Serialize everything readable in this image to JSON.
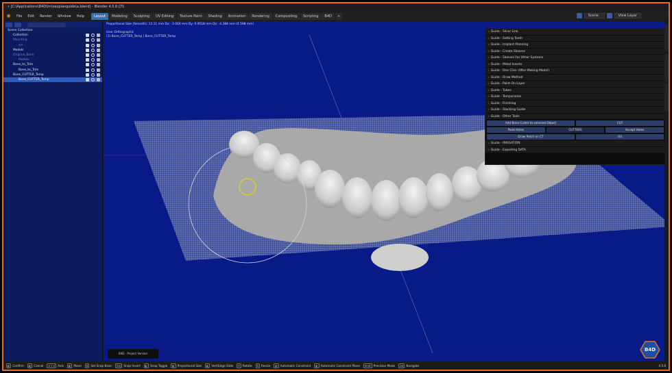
{
  "window": {
    "title": "• [C:\\Applications\\B4D\\lm\\seoplanguide\\a.blend] - Blender 4.5.8 LTS"
  },
  "menubar": {
    "menus": [
      "File",
      "Edit",
      "Render",
      "Window",
      "Help"
    ],
    "workspaces": [
      "Layout",
      "Modeling",
      "Sculpting",
      "UV Editing",
      "Texture Paint",
      "Shading",
      "Animation",
      "Rendering",
      "Compositing",
      "Scripting",
      "B4D"
    ],
    "active_workspace": "Layout",
    "plus": "+",
    "scene_label": "Scene",
    "view_layer_label": "View Layer"
  },
  "outliner": {
    "rows": [
      {
        "label": "Scene Collection",
        "indent": 0,
        "state": "normal",
        "icons": false
      },
      {
        "label": "Collection",
        "indent": 1,
        "state": "normal",
        "icons": true
      },
      {
        "label": "Mounting",
        "indent": 1,
        "state": "dim",
        "icons": true
      },
      {
        "label": "sm",
        "indent": 2,
        "state": "dim",
        "icons": true
      },
      {
        "label": "Models",
        "indent": 1,
        "state": "normal",
        "icons": true
      },
      {
        "label": "Original_Bone",
        "indent": 1,
        "state": "dim",
        "icons": true
      },
      {
        "label": "Models",
        "indent": 2,
        "state": "dim",
        "icons": true
      },
      {
        "label": "Bone_to_Trim",
        "indent": 1,
        "state": "normal",
        "icons": true
      },
      {
        "label": "Bone_to_Trim",
        "indent": 2,
        "state": "normal",
        "icons": true
      },
      {
        "label": "Bone_CUTTER_Temp",
        "indent": 1,
        "state": "normal",
        "icons": true
      },
      {
        "label": "Bone_CUTTER_Temp",
        "indent": 2,
        "state": "selected",
        "icons": true
      }
    ]
  },
  "viewport": {
    "view_name": "User Orthographic",
    "object_info": "(1) Bone_CUTTER_Temp | Bone_CUTTER_Temp",
    "header_info": "Proportional Size (Smooth): 13.11 mm   Dx: -1.004 mm   Dy: 0.9518 mm   Dz: -4.384 mm (4.598 mm)",
    "timeline_button": "B4D - Project Version Timeline"
  },
  "b4d_panel": {
    "guides_top": [
      "Guide - Slicer Link",
      "Guide - Setting Teeth",
      "Guide - Implant Planning",
      "Guide - Create Sleeves",
      "Guide - Sleeves For Other Systems",
      "Guide - Metal Inserts",
      "Guide - One Click  (After Making Model)",
      "Guide - Draw Method",
      "Guide - Paint-On-Layer",
      "Guide - Tubes",
      "Guide - Temporaries",
      "Guide - Finishing",
      "Guide - Stacking Guide",
      "Guide - Other Tools"
    ],
    "tool_buttons": {
      "add_bone_cutter": "Add Bone Cutter to selected Object",
      "cut": "CUT",
      "paint_holes": "Paint Holes",
      "cutters": "CUTTERS",
      "accept_holes": "Accept Holes",
      "draw_patch": "Draw Patch on CT",
      "fill": "Fill"
    },
    "guides_bottom": [
      "Guide - IRRIGATION",
      "Guide - Exporting DATA"
    ]
  },
  "statusbar": {
    "items": [
      {
        "key": "",
        "label": "Confirm"
      },
      {
        "key": "",
        "label": "Cancel"
      },
      {
        "key": "X Y Z",
        "label": "Axis"
      },
      {
        "key": "",
        "label": "Plane"
      },
      {
        "key": "B",
        "label": "Set Snap Base"
      },
      {
        "key": "Ctrl",
        "label": "Snap Invert"
      },
      {
        "key": "",
        "label": "Snap Toggle"
      },
      {
        "key": "",
        "label": "Proportional Size"
      },
      {
        "key": "",
        "label": "Vert/Edge Slide"
      },
      {
        "key": "R",
        "label": "Rotate"
      },
      {
        "key": "S",
        "label": "Resize"
      },
      {
        "key": "",
        "label": "Automatic Constraint"
      },
      {
        "key": "",
        "label": "Automatic Constraint Plane"
      },
      {
        "key": "Shift",
        "label": "Precision Mode"
      },
      {
        "key": "Alt",
        "label": "Navigate"
      }
    ],
    "version": "4.5.8"
  },
  "branding": {
    "logo_text": "B4D"
  },
  "colors": {
    "accent": "#e8701a",
    "viewport_bg": "#071a88",
    "selected": "#2f59b8"
  }
}
